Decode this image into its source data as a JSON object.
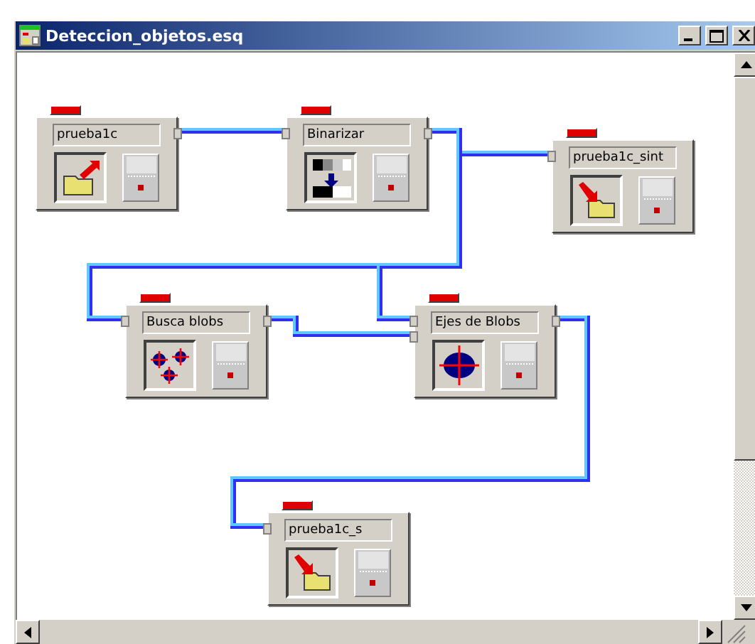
{
  "window": {
    "title": "Deteccion_objetos.esq"
  },
  "nodes": [
    {
      "label": "prueba1c",
      "kind": "open-file"
    },
    {
      "label": "Binarizar",
      "kind": "binarize"
    },
    {
      "label": "prueba1c_sint",
      "kind": "save-file"
    },
    {
      "label": "Busca blobs",
      "kind": "blobs"
    },
    {
      "label": "Ejes de Blobs",
      "kind": "blob-axes"
    },
    {
      "label": "prueba1c_s",
      "kind": "save-file"
    }
  ]
}
